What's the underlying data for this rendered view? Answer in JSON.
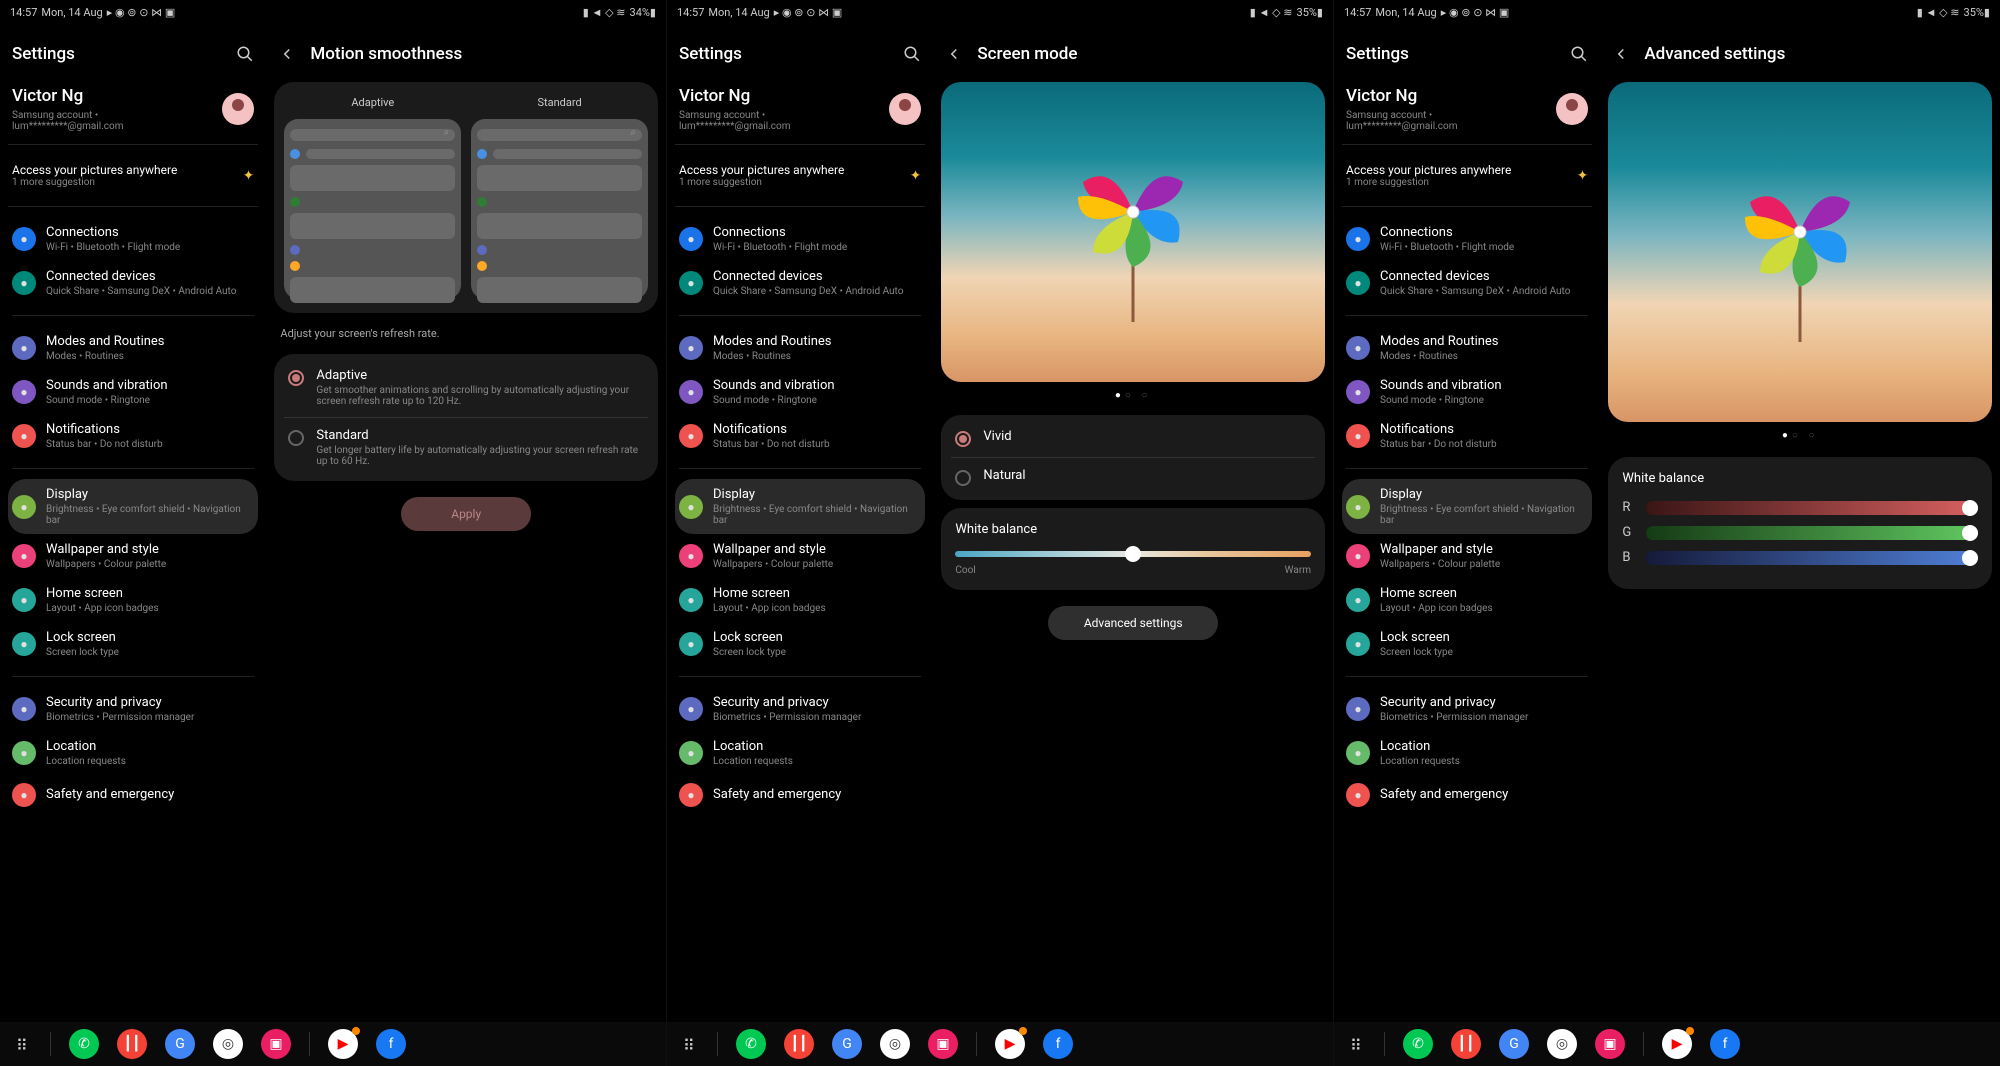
{
  "status": {
    "time": "14:57",
    "date": "Mon, 14 Aug",
    "battery1": "34%",
    "battery2": "35%"
  },
  "settings": {
    "title": "Settings",
    "account_name": "Victor Ng",
    "account_line1": "Samsung account •",
    "account_line2": "lum*********@gmail.com",
    "suggestion_title": "Access your pictures anywhere",
    "suggestion_sub": "1 more suggestion",
    "items": [
      {
        "title": "Connections",
        "sub": "Wi-Fi • Bluetooth • Flight mode",
        "color": "#1a73e8"
      },
      {
        "title": "Connected devices",
        "sub": "Quick Share • Samsung DeX • Android Auto",
        "color": "#00897b"
      },
      {
        "title": "Modes and Routines",
        "sub": "Modes • Routines",
        "color": "#5c6bc0",
        "dividerBefore": true
      },
      {
        "title": "Sounds and vibration",
        "sub": "Sound mode • Ringtone",
        "color": "#7e57c2"
      },
      {
        "title": "Notifications",
        "sub": "Status bar • Do not disturb",
        "color": "#ef5350"
      },
      {
        "title": "Display",
        "sub": "Brightness • Eye comfort shield • Navigation bar",
        "color": "#7cb342",
        "selected": true,
        "dividerBefore": true
      },
      {
        "title": "Wallpaper and style",
        "sub": "Wallpapers • Colour palette",
        "color": "#ec407a"
      },
      {
        "title": "Home screen",
        "sub": "Layout • App icon badges",
        "color": "#26a69a"
      },
      {
        "title": "Lock screen",
        "sub": "Screen lock type",
        "color": "#26a69a"
      },
      {
        "title": "Security and privacy",
        "sub": "Biometrics • Permission manager",
        "color": "#5c6bc0",
        "dividerBefore": true
      },
      {
        "title": "Location",
        "sub": "Location requests",
        "color": "#66bb6a"
      },
      {
        "title": "Safety and emergency",
        "sub": "",
        "color": "#ef5350"
      }
    ]
  },
  "motion": {
    "title": "Motion smoothness",
    "preview_a": "Adaptive",
    "preview_b": "Standard",
    "note": "Adjust your screen's refresh rate.",
    "options": [
      {
        "title": "Adaptive",
        "desc": "Get smoother animations and scrolling by automatically adjusting your screen refresh rate up to 120 Hz.",
        "checked": true
      },
      {
        "title": "Standard",
        "desc": "Get longer battery life by automatically adjusting your screen refresh rate up to 60 Hz.",
        "checked": false
      }
    ],
    "apply": "Apply"
  },
  "screenmode": {
    "title": "Screen mode",
    "options": [
      {
        "title": "Vivid",
        "checked": true
      },
      {
        "title": "Natural",
        "checked": false
      }
    ],
    "wb_title": "White balance",
    "cool": "Cool",
    "warm": "Warm",
    "adv": "Advanced settings"
  },
  "advanced": {
    "title": "Advanced settings",
    "wb_title": "White balance",
    "r": "R",
    "g": "G",
    "b": "B"
  },
  "taskbar": {
    "icons": [
      {
        "name": "phone",
        "bg": "#00c853",
        "glyph": "✆"
      },
      {
        "name": "recorder",
        "bg": "#f44336",
        "glyph": "┃┃"
      },
      {
        "name": "google",
        "bg": "#4285f4",
        "glyph": "G"
      },
      {
        "name": "chrome",
        "bg": "#fff",
        "glyph": "◎"
      },
      {
        "name": "gallery",
        "bg": "#e91e63",
        "glyph": "▣"
      }
    ],
    "recent": [
      {
        "name": "youtube",
        "bg": "#fff",
        "glyph": "▶",
        "badge": true
      },
      {
        "name": "facebook",
        "bg": "#1877f2",
        "glyph": "f"
      }
    ]
  }
}
